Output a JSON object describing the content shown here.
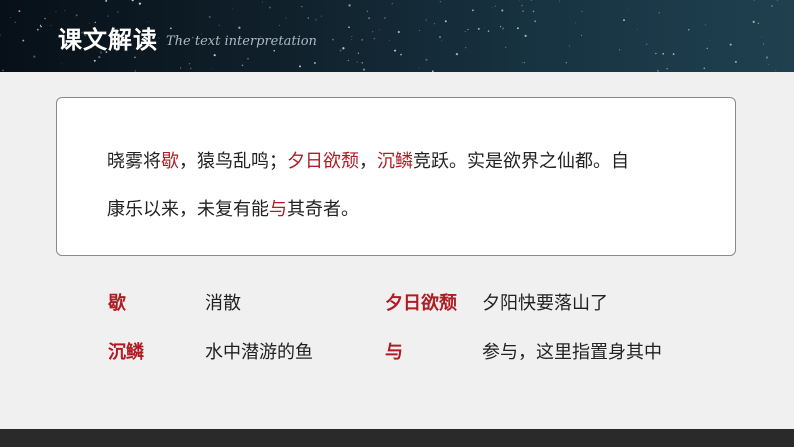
{
  "header": {
    "title": "课文解读",
    "subtitle": "The text interpretation"
  },
  "passage": {
    "line1": [
      {
        "text": "晓雾将",
        "hl": false
      },
      {
        "text": "歇",
        "hl": true
      },
      {
        "text": "，猿鸟乱鸣；",
        "hl": false
      },
      {
        "text": "夕日欲颓",
        "hl": true
      },
      {
        "text": "，",
        "hl": false
      },
      {
        "text": "沉鳞",
        "hl": true
      },
      {
        "text": "竞跃。实是欲界之仙都。自",
        "hl": false
      }
    ],
    "line2": [
      {
        "text": "康乐以来，未复有能",
        "hl": false
      },
      {
        "text": "与",
        "hl": true
      },
      {
        "text": "其奇者。",
        "hl": false
      }
    ]
  },
  "glossary": [
    {
      "term": "歇",
      "definition": "消散"
    },
    {
      "term": "夕日欲颓",
      "definition": "夕阳快要落山了"
    },
    {
      "term": "沉鳞",
      "definition": "水中潜游的鱼"
    },
    {
      "term": "与",
      "definition": "参与，这里指置身其中"
    }
  ],
  "colors": {
    "accent": "#b01c24",
    "text": "#222222",
    "background": "#f0f0f0",
    "header_dark": "#0b1720"
  }
}
